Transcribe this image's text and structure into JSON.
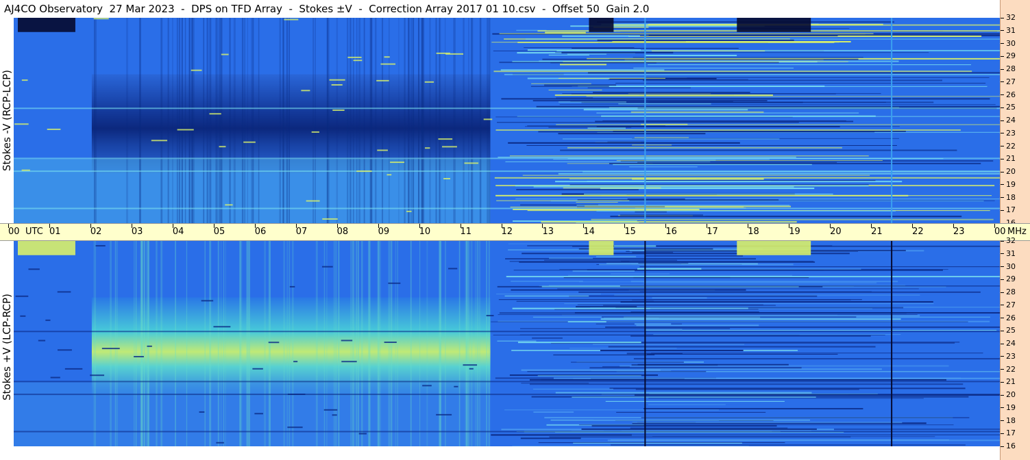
{
  "title": "AJ4CO Observatory  27 Mar 2023  -  DPS on TFD Array  -  Stokes ±V  -  Correction Array 2017 01 10.csv  -  Offset 50  Gain 2.0",
  "panels": [
    {
      "id": "top",
      "ylabel": "Stokes -V (RCP-LCP)"
    },
    {
      "id": "bottom",
      "ylabel": "Stokes +V (LCP-RCP)"
    }
  ],
  "time_axis": {
    "labels": [
      "00",
      "01",
      "02",
      "03",
      "04",
      "05",
      "06",
      "07",
      "08",
      "09",
      "10",
      "11",
      "12",
      "13",
      "14",
      "15",
      "16",
      "17",
      "18",
      "19",
      "20",
      "21",
      "22",
      "23",
      "00"
    ],
    "unit_left": "UTC",
    "unit_right": "MHz"
  },
  "freq_axis": {
    "labels": [
      "32",
      "31",
      "30",
      "29",
      "28",
      "27",
      "26",
      "25",
      "24",
      "23",
      "22",
      "21",
      "20",
      "19",
      "18",
      "17",
      "16"
    ]
  },
  "colors": {
    "base": "#2a6ee8",
    "dark": "#0b2a86",
    "light": "#7ae0f0",
    "bright": "#d8f06a",
    "freq_strip": "#fcdcc0",
    "time_strip": "#ffffcc"
  },
  "chart_data": {
    "type": "heatmap",
    "title": "AJ4CO Observatory  27 Mar 2023  -  DPS on TFD Array  -  Stokes ±V  -  Correction Array 2017 01 10.csv  -  Offset 50  Gain 2.0",
    "xlabel": "UTC",
    "ylabel": "MHz",
    "xlim": [
      0,
      24
    ],
    "ylim": [
      16,
      32
    ],
    "x_ticks": [
      "00",
      "01",
      "02",
      "03",
      "04",
      "05",
      "06",
      "07",
      "08",
      "09",
      "10",
      "11",
      "12",
      "13",
      "14",
      "15",
      "16",
      "17",
      "18",
      "19",
      "20",
      "21",
      "22",
      "23",
      "00"
    ],
    "y_ticks": [
      32,
      31,
      30,
      29,
      28,
      27,
      26,
      25,
      24,
      23,
      22,
      21,
      20,
      19,
      18,
      17,
      16
    ],
    "series": [
      {
        "name": "Stokes -V (RCP-LCP)"
      },
      {
        "name": "Stokes +V (LCP-RCP)"
      }
    ]
  }
}
